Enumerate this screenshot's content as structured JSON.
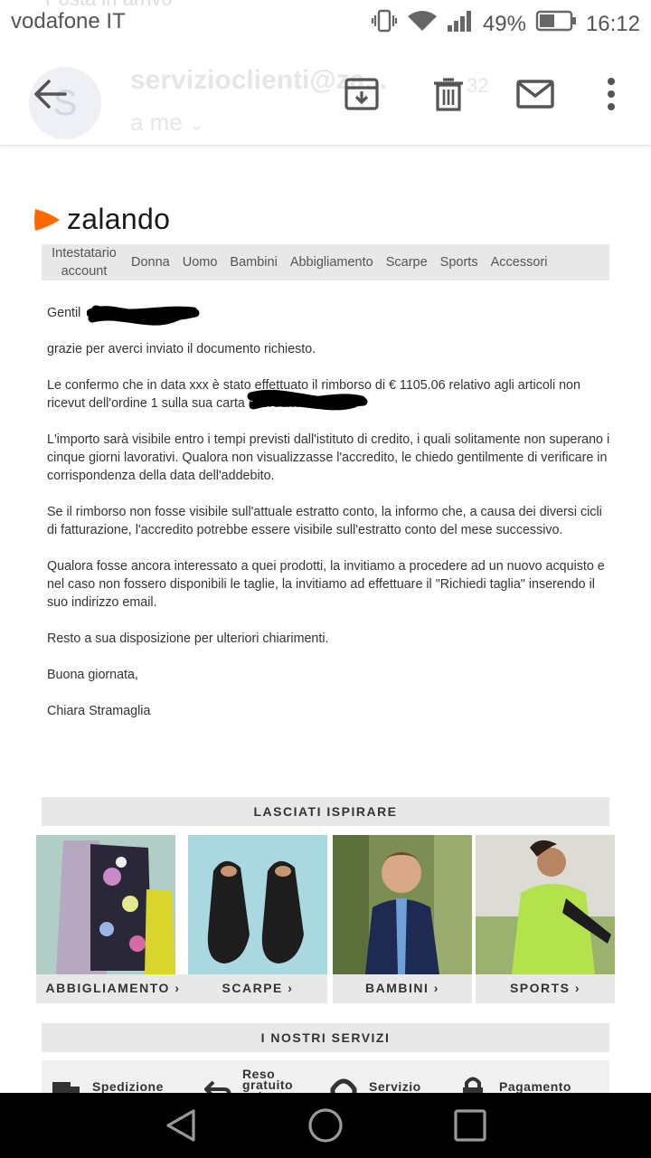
{
  "status_bar": {
    "carrier": "vodafone IT",
    "battery": "49%",
    "time": "16:12"
  },
  "background_header": {
    "text": "Posta in arrivo"
  },
  "email_header": {
    "avatar_letter": "S",
    "sender": "servizioclienti@za...",
    "time": "32",
    "recipient": "a me"
  },
  "brand": {
    "name": "zalando",
    "accent": "#ff6900"
  },
  "nav": {
    "items": [
      "Intestatario account",
      "Donna",
      "Uomo",
      "Bambini",
      "Abbigliamento",
      "Scarpe",
      "Sports",
      "Accessori"
    ]
  },
  "message": {
    "greeting": "Gentil",
    "p1": "grazie per averci inviato il documento richiesto.",
    "p2": "Le confermo che in data xxx è stato effettuato il rimborso di € 1105.06 relativo agli articoli non ricevut dell'ordine 1 sulla sua carta di credito.",
    "p3": "L'importo sarà visibile entro i tempi previsti dall'istituto di credito, i quali solitamente non superano i cinque giorni lavorativi. Qualora non visualizzasse l'accredito, le chiedo gentilmente di verificare in corrispondenza della data dell'addebito.",
    "p4": "Se il rimborso non fosse visibile sull'attuale estratto conto, la informo che, a causa dei diversi cicli di fatturazione, l'accredito potrebbe essere visibile sull'estratto conto del mese successivo.",
    "p5": "Qualora fosse ancora interessato a quei prodotti, la invitiamo a procedere ad un nuovo acquisto e nel caso non fossero disponibili le taglie, la invitiamo ad effettuare il \"Richiedi taglia\" inserendo il suo indirizzo email.",
    "p6": "Resto a sua disposizione per ulteriori chiarimenti.",
    "p7": "Buona giornata,",
    "signature": "Chiara Stramaglia"
  },
  "inspire": {
    "title": "LASCIATI ISPIRARE",
    "tiles": [
      "ABBIGLIAMENTO ›",
      "SCARPE ›",
      "BAMBINI ›",
      "SPORTS ›"
    ]
  },
  "services": {
    "title": "I NOSTRI SERVIZI",
    "items": [
      "Spedizione",
      "Reso gratuito entro",
      "Servizio",
      "Pagamento"
    ]
  }
}
